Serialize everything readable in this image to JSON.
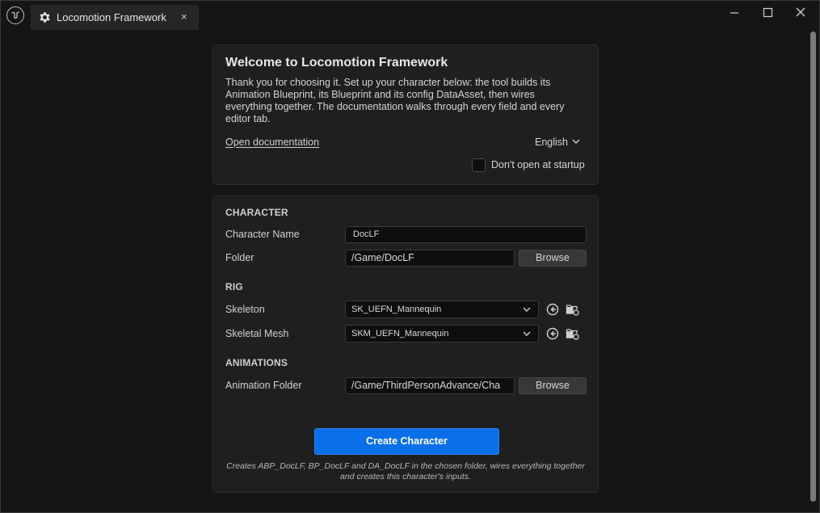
{
  "window": {
    "tab_title": "Locomotion Framework",
    "tab_close": "×",
    "icons": [
      "unreal-logo-icon",
      "gear-icon",
      "close-icon",
      "minimize-icon",
      "maximize-icon",
      "window-close-icon"
    ]
  },
  "welcome": {
    "title": "Welcome to Locomotion Framework",
    "body": "Thank you for choosing it. Set up your character below: the tool builds its Animation Blueprint, its Blueprint and its config DataAsset, then wires everything together. The documentation walks through every field and every editor tab.",
    "doc_link": "Open documentation",
    "language": "English",
    "dont_open_label": "Don't open at startup",
    "dont_open_checked": false
  },
  "character": {
    "section": "CHARACTER",
    "name_label": "Character Name",
    "name_value": "DocLF",
    "folder_label": "Folder",
    "folder_value": "/Game/DocLF",
    "browse_label": "Browse"
  },
  "rig": {
    "section": "RIG",
    "skeleton_label": "Skeleton",
    "skeleton_value": "SK_UEFN_Mannequin",
    "mesh_label": "Skeletal Mesh",
    "mesh_value": "SKM_UEFN_Mannequin"
  },
  "animations": {
    "section": "ANIMATIONS",
    "folder_label": "Animation Folder",
    "folder_value": "/Game/ThirdPersonAdvance/Cha",
    "browse_label": "Browse"
  },
  "create": {
    "button_label": "Create Character",
    "hint": "Creates ABP_DocLF, BP_DocLF and DA_DocLF in the chosen folder, wires everything together and creates this character's inputs."
  },
  "colors": {
    "accent": "#0a6fe8",
    "background": "#151515",
    "panel": "#1f1f1f"
  }
}
